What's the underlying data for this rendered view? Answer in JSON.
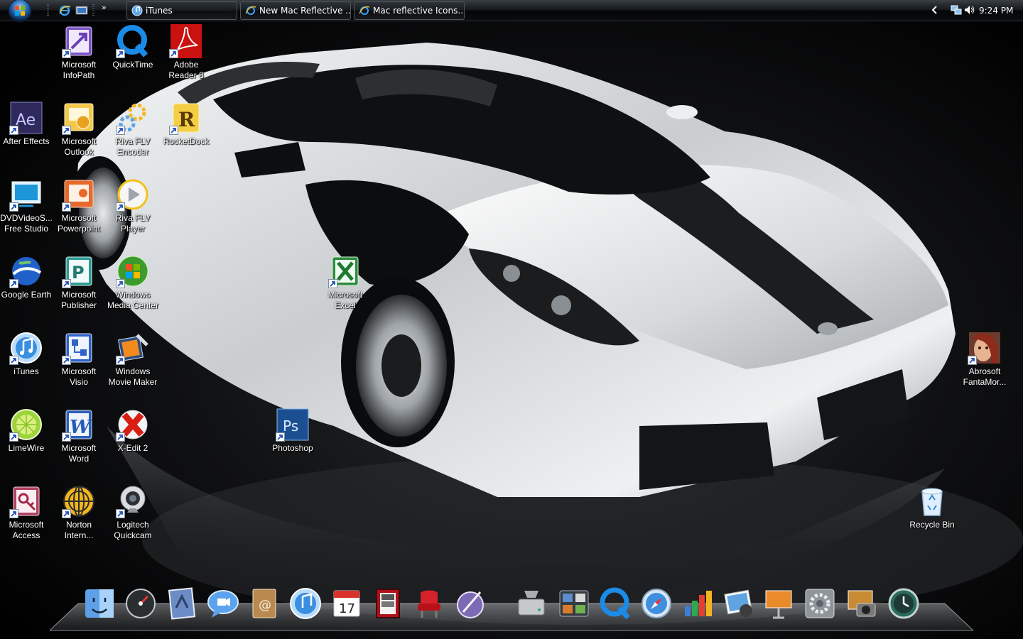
{
  "taskbar": {
    "tasks": [
      {
        "label": "iTunes"
      },
      {
        "label": "New Mac Reflective ..."
      },
      {
        "label": "Mac reflective Icons..."
      }
    ],
    "clock": "9:24 PM"
  },
  "desktop": {
    "icons": [
      {
        "label": "Microsoft InfoPath",
        "icon": "infopath-icon"
      },
      {
        "label": "QuickTime",
        "icon": "quicktime-icon"
      },
      {
        "label": "Adobe Reader 8",
        "icon": "adobe-reader-icon"
      },
      {
        "label": "After Effects",
        "icon": "after-effects-icon"
      },
      {
        "label": "Microsoft Outlook",
        "icon": "outlook-icon"
      },
      {
        "label": "Riva FLV Encoder",
        "icon": "riva-encoder-icon"
      },
      {
        "label": "RocketDock",
        "icon": "rocketdock-icon"
      },
      {
        "label": "DVDVideoS... Free Studio",
        "icon": "dvdvideosoft-icon"
      },
      {
        "label": "Microsoft Powerpoint",
        "icon": "powerpoint-icon"
      },
      {
        "label": "Riva FLV Player",
        "icon": "riva-player-icon"
      },
      {
        "label": "Google Earth",
        "icon": "google-earth-icon"
      },
      {
        "label": "Microsoft Publisher",
        "icon": "publisher-icon"
      },
      {
        "label": "Windows Media Center",
        "icon": "media-center-icon"
      },
      {
        "label": "Microsoft Excel",
        "icon": "excel-icon"
      },
      {
        "label": "iTunes",
        "icon": "itunes-icon"
      },
      {
        "label": "Microsoft Visio",
        "icon": "visio-icon"
      },
      {
        "label": "Windows Movie Maker",
        "icon": "movie-maker-icon"
      },
      {
        "label": "Abrosoft FantaMor...",
        "icon": "fantamorph-icon"
      },
      {
        "label": "LimeWire",
        "icon": "limewire-icon"
      },
      {
        "label": "Microsoft Word",
        "icon": "word-icon"
      },
      {
        "label": "X-Edit 2",
        "icon": "x-edit-icon"
      },
      {
        "label": "Photoshop",
        "icon": "photoshop-icon"
      },
      {
        "label": "Microsoft Access",
        "icon": "access-icon"
      },
      {
        "label": "Norton Intern...",
        "icon": "norton-icon"
      },
      {
        "label": "Logitech Quickcam",
        "icon": "quickcam-icon"
      },
      {
        "label": "Recycle Bin",
        "icon": "recycle-bin-icon"
      }
    ]
  },
  "dock": {
    "items": [
      "finder-icon",
      "dashboard-icon",
      "mail-icon",
      "ichat-icon",
      "address-book-icon",
      "itunes-icon",
      "ical-icon",
      "photo-booth-icon",
      "front-row-icon",
      "script-editor-icon",
      "disk-utility-icon",
      "expose-icon",
      "quicktime-icon",
      "safari-icon",
      "numbers-icon",
      "iphoto-icon",
      "keynote-icon",
      "system-preferences-icon",
      "image-capture-icon",
      "time-machine-icon"
    ],
    "calendar_day": "17"
  },
  "colors": {
    "label_text": "#ffffff",
    "taskbar": "#0b0c0e"
  }
}
